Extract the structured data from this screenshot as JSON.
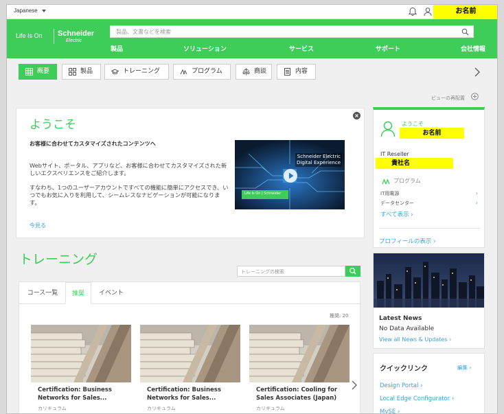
{
  "topbar": {
    "language": "Japanese",
    "username": "お名前"
  },
  "brand": {
    "tagline": "Life Is On",
    "name": "Schneider",
    "sub": "Electric"
  },
  "search": {
    "placeholder": "製品、文書などを検索"
  },
  "nav": [
    "製品",
    "ソリューション",
    "サービス",
    "サポート",
    "会社情報"
  ],
  "tabs": [
    "概要",
    "製品",
    "トレーニング",
    "プログラム",
    "商談",
    "内容"
  ],
  "rearrange_label": "ビューの再配置",
  "welcome": {
    "title": "ようこそ",
    "heading": "お客様に合わせてカスタマイズされたコンテンツへ",
    "p1": "Webサイト、ポータル、アプリなど、お客様に合わせてカスタマイズされた新しいエクスペリエンスをご紹介します。",
    "p2": "すなわち、1つのユーザーアカウントですべての機能に簡単にアクセスでき、いつでもお気に入りを利用して、シームレスなナビゲーションが可能になります。",
    "more": "今見る",
    "video_title_1": "Schneider Electric",
    "video_title_2": "Digital Experience",
    "video_bar": "Life Is On | Schneider"
  },
  "training": {
    "title": "トレーニング",
    "search_placeholder": "トレーニングの検索",
    "tabs": [
      "コース一覧",
      "推奨",
      "イベント"
    ],
    "count_label": "推奨: 20",
    "courses": [
      {
        "title": "Certification: Business Networks for Sales...",
        "category": "カリキュラム"
      },
      {
        "title": "Certification: Business Networks for Sales...",
        "category": "カリキュラム"
      },
      {
        "title": "Certification: Cooling for Sales Associates (Japan)",
        "category": "カリキュラム"
      }
    ]
  },
  "profile": {
    "welcome": "ようこそ",
    "name": "お名前",
    "role": "IT Reseller",
    "company": "貴社名",
    "programs_label": "プログラム",
    "programs": [
      "IT用電源",
      "データセンター"
    ],
    "see_all": "すべて表示",
    "view_profile": "プロフィールの表示"
  },
  "news": {
    "title": "Latest News",
    "none": "No Data Available",
    "link": "View all News & Updates"
  },
  "quicklinks": {
    "title": "クイックリンク",
    "edit": "編集",
    "links": [
      "Design Portal",
      "Local Edge Configurator",
      "MySE"
    ]
  },
  "colors": {
    "brand_green": "#3dcd58",
    "link_blue": "#3aa0d8",
    "highlight_yellow": "#ffff00"
  },
  "icons": [
    "bell-icon",
    "user-icon",
    "search-icon",
    "grid-icon",
    "program-icon",
    "play-icon",
    "chevron-right-icon",
    "close-icon"
  ]
}
